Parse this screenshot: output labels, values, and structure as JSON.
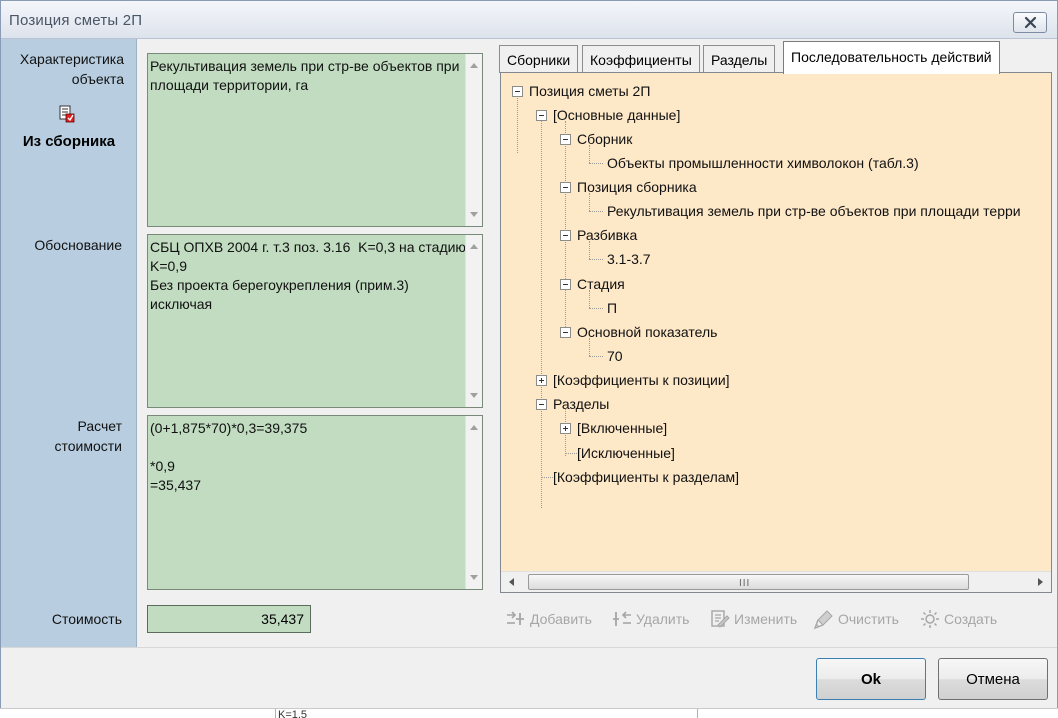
{
  "window": {
    "title": "Позиция сметы 2П"
  },
  "left_panel": {
    "characteristic_label": "Характеристика объекта",
    "source_label": "Из сборника",
    "justification_label": "Обоснование",
    "calculation_label": "Расчет стоимости",
    "cost_label": "Стоимость"
  },
  "fields": {
    "characteristic": "Рекультивация земель при стр-ве объектов при площади территории, га",
    "justification": "СБЦ ОПХВ 2004 г. т.3 поз. 3.16  K=0,3 на стадию\nK=0,9\nБез проекта берегоукрепления (прим.3) исключая",
    "calculation": "(0+1,875*70)*0,3=39,375\n\n*0,9\n=35,437",
    "cost": "35,437"
  },
  "tabs": [
    {
      "label": "Сборники",
      "active": false
    },
    {
      "label": "Коэффициенты",
      "active": false
    },
    {
      "label": "Разделы",
      "active": false
    },
    {
      "label": "Последовательность действий",
      "active": true
    }
  ],
  "tree": {
    "root": "Позиция сметы 2П",
    "main_data": "[Основные данные]",
    "collection": "Сборник",
    "collection_value": "Объекты промышленности химволокон (табл.3)",
    "collection_position": "Позиция сборника",
    "collection_position_value": "Рекультивация земель при стр-ве объектов при площади терри",
    "breakdown": "Разбивка",
    "breakdown_value": "3.1-3.7",
    "stage": "Стадия",
    "stage_value": "П",
    "main_indicator": "Основной показатель",
    "main_indicator_value": "70",
    "position_coefficients": "[Коэффициенты к позиции]",
    "sections": "Разделы",
    "included": "[Включенные]",
    "excluded": "[Исключенные]",
    "section_coefficients": "[Коэффициенты к разделам]"
  },
  "hscroll_grip": "III",
  "toolbar": {
    "add": "Добавить",
    "delete": "Удалить",
    "edit": "Изменить",
    "clear": "Очистить",
    "create": "Создать"
  },
  "buttons": {
    "ok": "Ok",
    "cancel": "Отмена"
  },
  "underside_text": "K=1,5",
  "colors": {
    "left_panel": "#b8cee0",
    "field_bg": "#c1dcc1",
    "tree_bg": "#fde8c8"
  }
}
